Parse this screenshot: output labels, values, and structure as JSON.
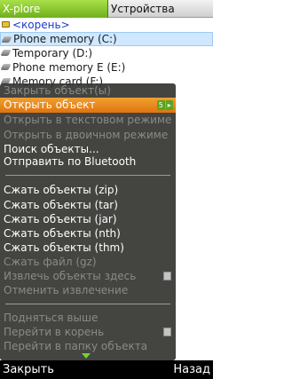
{
  "tabs": [
    {
      "label": "X-plore",
      "active": true
    },
    {
      "label": "Устройства",
      "active": false
    }
  ],
  "file_list": [
    {
      "label": "<корень>",
      "icon": "folder-icon"
    },
    {
      "label": "Phone memory (C:)",
      "icon": "disk-icon",
      "selected": true
    },
    {
      "label": "Temporary (D:)",
      "icon": "disk-icon"
    },
    {
      "label": "Phone memory E (E:)",
      "icon": "disk-icon"
    },
    {
      "label": "Memory card (F:)",
      "icon": "disk-icon"
    }
  ],
  "menu": {
    "items": [
      {
        "label": "Закрыть объект(ы)",
        "state": "disabled"
      },
      {
        "label": "Открыть объект",
        "state": "highlight",
        "badge": [
          "5",
          "▸"
        ]
      },
      {
        "label": "Открыть в текстовом режиме",
        "state": "disabled"
      },
      {
        "label": "Открыть в двоичном режиме",
        "state": "disabled"
      },
      {
        "label": "Поиск объекты...",
        "state": "enabled"
      },
      {
        "label": "Отправить по Bluetooth",
        "state": "enabled"
      },
      {
        "label": "Сжать объекты (zip)",
        "state": "enabled"
      },
      {
        "label": "Сжать объекты (tar)",
        "state": "enabled"
      },
      {
        "label": "Сжать объекты (jar)",
        "state": "enabled"
      },
      {
        "label": "Сжать объекты (nth)",
        "state": "enabled"
      },
      {
        "label": "Сжать объекты (thm)",
        "state": "enabled"
      },
      {
        "label": "Сжать файл (gz)",
        "state": "disabled"
      },
      {
        "label": "Извлечь объекты здесь",
        "state": "disabled",
        "icon": "file-icon"
      },
      {
        "label": "Отменить извлечение",
        "state": "disabled"
      },
      {
        "label": "Подняться выше",
        "state": "disabled"
      },
      {
        "label": "Перейти в корень",
        "state": "disabled",
        "icon": "file-icon"
      },
      {
        "label": "Перейти в папку объекта",
        "state": "disabled"
      }
    ]
  },
  "softkeys": {
    "left": "Закрыть",
    "right": "Назад"
  },
  "colors": {
    "tab_active": "#6fb01c",
    "menu_bg": "#30302c",
    "highlight": "#e07410",
    "selected_row": "#cfe8ff"
  }
}
